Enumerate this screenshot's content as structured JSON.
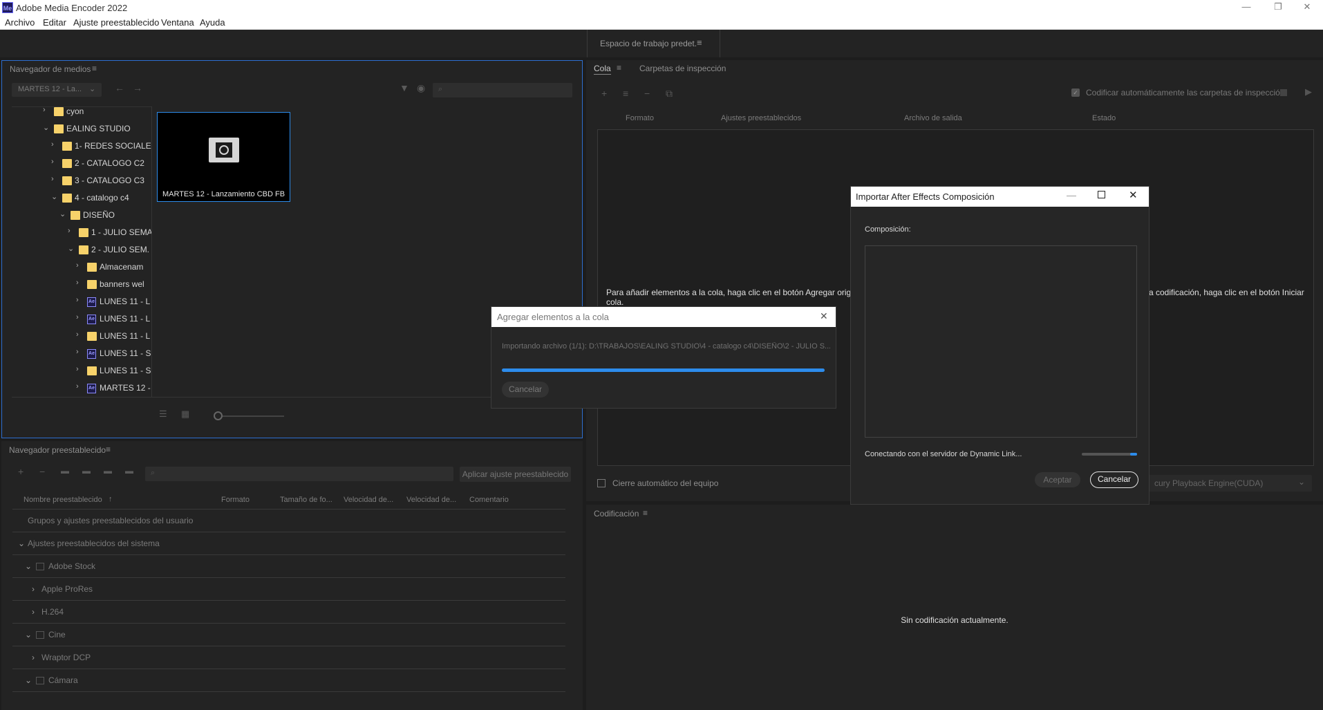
{
  "app": {
    "title": "Adobe Media Encoder 2022",
    "logo": "Me"
  },
  "window_controls": {
    "minimize": "—",
    "restore": "❐",
    "close": "✕"
  },
  "menu": [
    "Archivo",
    "Editar",
    "Ajuste preestablecido",
    "Ventana",
    "Ayuda"
  ],
  "workspace": {
    "label": "Espacio de trabajo predet.",
    "menu_icon": "≡"
  },
  "media_browser": {
    "title": "Navegador de medios",
    "location": "MARTES 12 - La...",
    "search_placeholder": "",
    "tree": [
      {
        "label": "cyon",
        "type": "folder",
        "expanded": false,
        "indent": 0
      },
      {
        "label": "EALING STUDIO",
        "type": "folder",
        "expanded": true,
        "indent": 0
      },
      {
        "label": "1- REDES SOCIALES",
        "type": "folder",
        "expanded": false,
        "indent": 1
      },
      {
        "label": "2 - CATALOGO C2",
        "type": "folder",
        "expanded": false,
        "indent": 1
      },
      {
        "label": "3 - CATALOGO C3",
        "type": "folder",
        "expanded": false,
        "indent": 1
      },
      {
        "label": "4 - catalogo c4",
        "type": "folder",
        "expanded": true,
        "indent": 1
      },
      {
        "label": "DISEÑO",
        "type": "folder",
        "expanded": true,
        "indent": 2
      },
      {
        "label": "1 - JULIO SEMA",
        "type": "folder",
        "expanded": false,
        "indent": 3
      },
      {
        "label": "2 - JULIO SEM.",
        "type": "folder",
        "expanded": true,
        "indent": 3
      },
      {
        "label": "Almacenam",
        "type": "folder",
        "expanded": false,
        "indent": 4
      },
      {
        "label": "banners wel",
        "type": "folder",
        "expanded": false,
        "indent": 4
      },
      {
        "label": "LUNES 11 - L",
        "type": "ae",
        "expanded": false,
        "indent": 4
      },
      {
        "label": "LUNES 11 - L",
        "type": "ae",
        "expanded": false,
        "indent": 4
      },
      {
        "label": "LUNES 11 - L",
        "type": "folder",
        "expanded": false,
        "indent": 4
      },
      {
        "label": "LUNES 11 - S",
        "type": "ae",
        "expanded": false,
        "indent": 4
      },
      {
        "label": "LUNES 11 - S",
        "type": "folder",
        "expanded": false,
        "indent": 4
      },
      {
        "label": "MARTES 12 -",
        "type": "ae",
        "expanded": false,
        "indent": 4
      }
    ],
    "thumbnail_label": "MARTES 12 - Lanzamiento CBD FB"
  },
  "preset_browser": {
    "title": "Navegador preestablecido",
    "apply_button": "Aplicar ajuste preestablecido",
    "columns": [
      "Nombre preestablecido",
      "Formato",
      "Tamaño de fo...",
      "Velocidad de...",
      "Velocidad de...",
      "Comentario"
    ],
    "sort_indicator": "↑",
    "rows": [
      {
        "label": "Grupos y ajustes preestablecidos del usuario",
        "indent": 0,
        "chevron": ""
      },
      {
        "label": "Ajustes preestablecidos del sistema",
        "indent": 0,
        "chevron": "v"
      },
      {
        "label": "Adobe Stock",
        "indent": 1,
        "chevron": "v"
      },
      {
        "label": "Apple ProRes",
        "indent": 2,
        "chevron": ">"
      },
      {
        "label": "H.264",
        "indent": 2,
        "chevron": ">"
      },
      {
        "label": "Cine",
        "indent": 1,
        "chevron": "v"
      },
      {
        "label": "Wraptor DCP",
        "indent": 2,
        "chevron": ">"
      },
      {
        "label": "Cámara",
        "indent": 1,
        "chevron": "v"
      }
    ]
  },
  "queue": {
    "tabs": [
      "Cola",
      "Carpetas de inspección"
    ],
    "auto_encode_label": "Codificar automáticamente las carpetas de inspección",
    "columns": [
      "Formato",
      "Ajustes preestablecidos",
      "Archivo de salida",
      "Estado"
    ],
    "message_left": "Para añadir elementos a la cola, haga clic en el botón Agregar origen o",
    "message_left_2": "cola.",
    "message_right": "a codificación, haga clic en el botón Iniciar",
    "shutdown_label": "Cierre automático del equipo",
    "renderer": "cury Playback Engine(CUDA)"
  },
  "encoding": {
    "title": "Codificación",
    "empty_message": "Sin codificación actualmente."
  },
  "add_dialog": {
    "title": "Agregar elementos a la cola",
    "status": "Importando archivo (1/1): D:\\TRABAJOS\\EALING STUDIO\\4 - catalogo c4\\DISEÑO\\2 - JULIO S...",
    "progress": 1.0,
    "cancel": "Cancelar"
  },
  "ae_dialog": {
    "title": "Importar After Effects Composición",
    "composition_label": "Composición:",
    "status": "Conectando con el servidor de Dynamic Link...",
    "progress": 0.12,
    "accept": "Aceptar",
    "cancel": "Cancelar"
  },
  "colors": {
    "accent": "#2d8ceb",
    "panel": "#232323",
    "bg": "#1d1d1d",
    "folder": "#f7d26a"
  }
}
